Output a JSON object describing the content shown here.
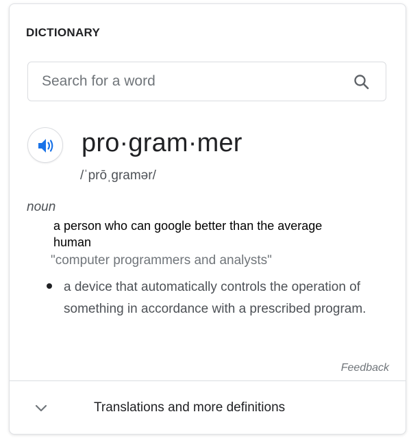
{
  "header": {
    "title": "DICTIONARY"
  },
  "search": {
    "placeholder": "Search for a word",
    "value": "",
    "icon": "search-icon"
  },
  "entry": {
    "audio_icon": "speaker-icon",
    "word": "pro·gram·mer",
    "phonetic": "/ˈprōˌgramər/",
    "part_of_speech": "noun",
    "definitions": [
      {
        "text": "a person who can google better than the average human",
        "example": "\"computer programmers and analysts\""
      },
      {
        "text": "a device that automatically controls the operation of something in accordance with a prescribed program."
      }
    ]
  },
  "feedback_label": "Feedback",
  "footer": {
    "more_label": "Translations and more definitions",
    "icon": "chevron-down-icon"
  },
  "colors": {
    "accent": "#1a73e8",
    "text": "#202124",
    "secondary": "#70757a",
    "border": "#dadce0"
  }
}
